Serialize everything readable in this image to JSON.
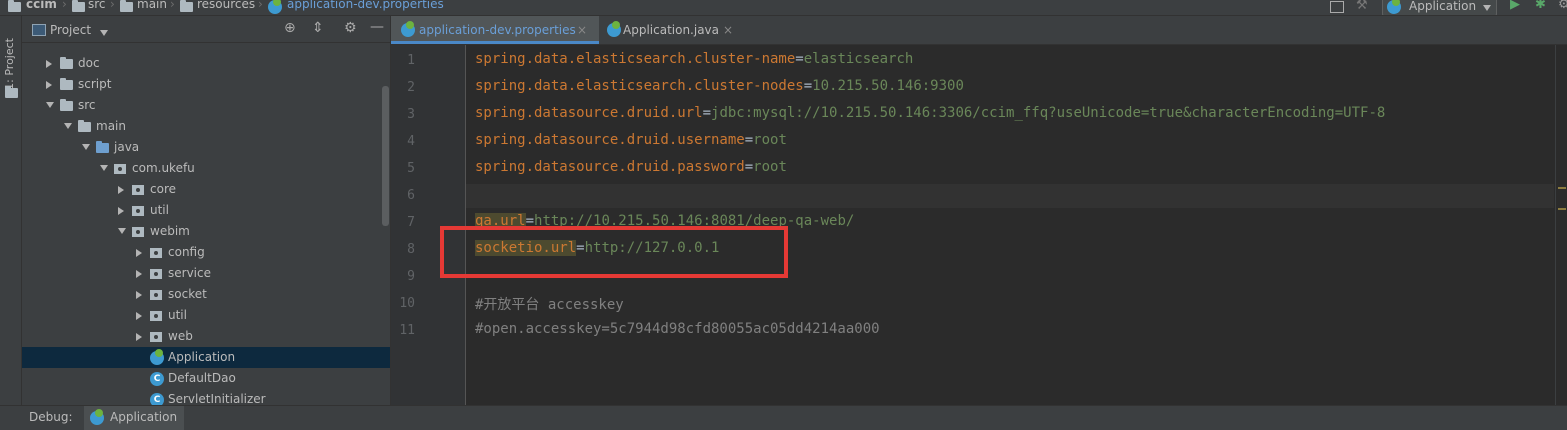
{
  "breadcrumb": {
    "items": [
      "ccim",
      "src",
      "main",
      "resources",
      "application-dev.properties"
    ]
  },
  "toolbar": {
    "run_config": "Application"
  },
  "left_strip": {
    "label": "1: Project"
  },
  "project_panel": {
    "title": "Project",
    "rows": [
      {
        "label": "doc",
        "type": "folder",
        "indent": 1,
        "expanded": false
      },
      {
        "label": "script",
        "type": "folder",
        "indent": 1,
        "expanded": false
      },
      {
        "label": "src",
        "type": "folder",
        "indent": 1,
        "expanded": true
      },
      {
        "label": "main",
        "type": "folder",
        "indent": 2,
        "expanded": true
      },
      {
        "label": "java",
        "type": "folder-blue",
        "indent": 3,
        "expanded": true
      },
      {
        "label": "com.ukefu",
        "type": "package",
        "indent": 4,
        "expanded": true
      },
      {
        "label": "core",
        "type": "package",
        "indent": 5,
        "expanded": false
      },
      {
        "label": "util",
        "type": "package",
        "indent": 5,
        "expanded": false
      },
      {
        "label": "webim",
        "type": "package",
        "indent": 5,
        "expanded": true
      },
      {
        "label": "config",
        "type": "package",
        "indent": 6,
        "expanded": false
      },
      {
        "label": "service",
        "type": "package",
        "indent": 6,
        "expanded": false
      },
      {
        "label": "socket",
        "type": "package",
        "indent": 6,
        "expanded": false
      },
      {
        "label": "util",
        "type": "package",
        "indent": 6,
        "expanded": false
      },
      {
        "label": "web",
        "type": "package",
        "indent": 6,
        "expanded": false
      },
      {
        "label": "Application",
        "type": "spring-class",
        "indent": 6,
        "selected": true
      },
      {
        "label": "DefaultDao",
        "type": "class",
        "indent": 6
      },
      {
        "label": "ServletInitializer",
        "type": "class",
        "indent": 6
      }
    ]
  },
  "tabs": [
    {
      "label": "application-dev.properties",
      "active": true
    },
    {
      "label": "Application.java",
      "active": false
    }
  ],
  "editor": {
    "lines": [
      {
        "n": "1",
        "key": "spring.data.elasticsearch.cluster-name",
        "eq": "=",
        "val": "elasticsearch"
      },
      {
        "n": "2",
        "key": "spring.data.elasticsearch.cluster-nodes",
        "eq": "=",
        "val": "10.215.50.146:9300"
      },
      {
        "n": "3",
        "key": "spring.datasource.druid.url",
        "eq": "=",
        "val": "jdbc:mysql://10.215.50.146:3306/ccim_ffq?useUnicode=true&characterEncoding=UTF-8"
      },
      {
        "n": "4",
        "key": "spring.datasource.druid.username",
        "eq": "=",
        "val": "root"
      },
      {
        "n": "5",
        "key": "spring.datasource.druid.password",
        "eq": "=",
        "val": "root"
      },
      {
        "n": "6",
        "key": "",
        "eq": "",
        "val": ""
      },
      {
        "n": "7",
        "key": "qa.url",
        "eq": "=",
        "val": "http://10.215.50.146:8081/deep-qa-web/"
      },
      {
        "n": "8",
        "key": "socketio.url",
        "eq": "=",
        "val": "http://127.0.0.1"
      },
      {
        "n": "9",
        "key": "",
        "eq": "",
        "val": ""
      },
      {
        "n": "10",
        "comment": "#开放平台 accesskey"
      },
      {
        "n": "11",
        "comment": "#open.accesskey=5c7944d98cfd80055ac05dd4214aa000"
      }
    ]
  },
  "bottom_bar": {
    "debug_label": "Debug:",
    "app_label": "Application"
  },
  "colors": {
    "highlight_box": "#e53935",
    "selection": "#0d293e",
    "tab_underline": "#4a88c7"
  }
}
